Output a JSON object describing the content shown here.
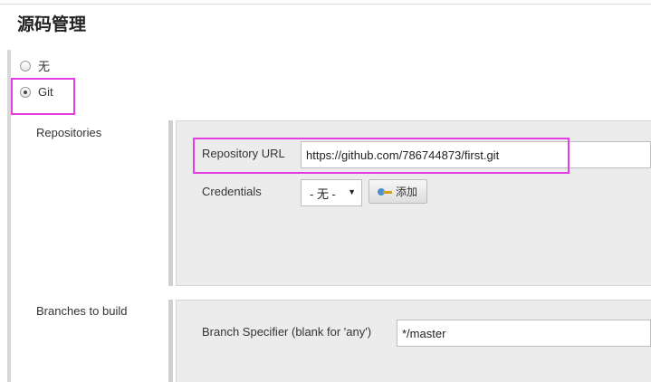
{
  "section": {
    "title": "源码管理"
  },
  "scm_options": [
    {
      "label": "无",
      "checked": false
    },
    {
      "label": "Git",
      "checked": true
    }
  ],
  "repositories": {
    "label": "Repositories",
    "url_label": "Repository URL",
    "url_value": "https://github.com/786744873/first.git",
    "credentials_label": "Credentials",
    "credentials_selected": "- 无 -",
    "add_button_label": "添加"
  },
  "branches": {
    "label": "Branches to build",
    "specifier_label": "Branch Specifier (blank for 'any')",
    "specifier_value": "*/master"
  },
  "icons": {
    "select_arrow": "caret-down-icon",
    "add": "key-icon"
  },
  "colors": {
    "highlight": "#e23ee2",
    "panel": "#ececec"
  }
}
